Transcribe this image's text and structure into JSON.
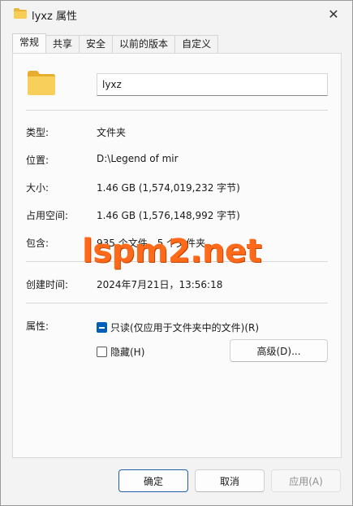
{
  "window": {
    "title": "lyxz 属性"
  },
  "tabs": [
    {
      "label": "常规"
    },
    {
      "label": "共享"
    },
    {
      "label": "安全"
    },
    {
      "label": "以前的版本"
    },
    {
      "label": "自定义"
    }
  ],
  "name_field": {
    "value": "lyxz"
  },
  "rows": {
    "type": {
      "label": "类型:",
      "value": "文件夹"
    },
    "location": {
      "label": "位置:",
      "value": "D:\\Legend of mir"
    },
    "size": {
      "label": "大小:",
      "value": "1.46 GB (1,574,019,232 字节)"
    },
    "size_on_disk": {
      "label": "占用空间:",
      "value": "1.46 GB (1,576,148,992 字节)"
    },
    "contains": {
      "label": "包含:",
      "value": "935 个文件，5 个文件夹"
    },
    "created": {
      "label": "创建时间:",
      "value": "2024年7月21日，13:56:18"
    }
  },
  "attributes": {
    "label": "属性:",
    "readonly_label": "只读(仅应用于文件夹中的文件)(R)",
    "readonly_state": "indeterminate",
    "hidden_label": "隐藏(H)",
    "hidden_state": "unchecked",
    "advanced_button": "高级(D)..."
  },
  "footer": {
    "ok": "确定",
    "cancel": "取消",
    "apply": "应用(A)"
  },
  "watermark": "lspm2.net",
  "colors": {
    "accent": "#005fb8",
    "watermark": "#ff6a1a",
    "folder": "#f4c542"
  }
}
